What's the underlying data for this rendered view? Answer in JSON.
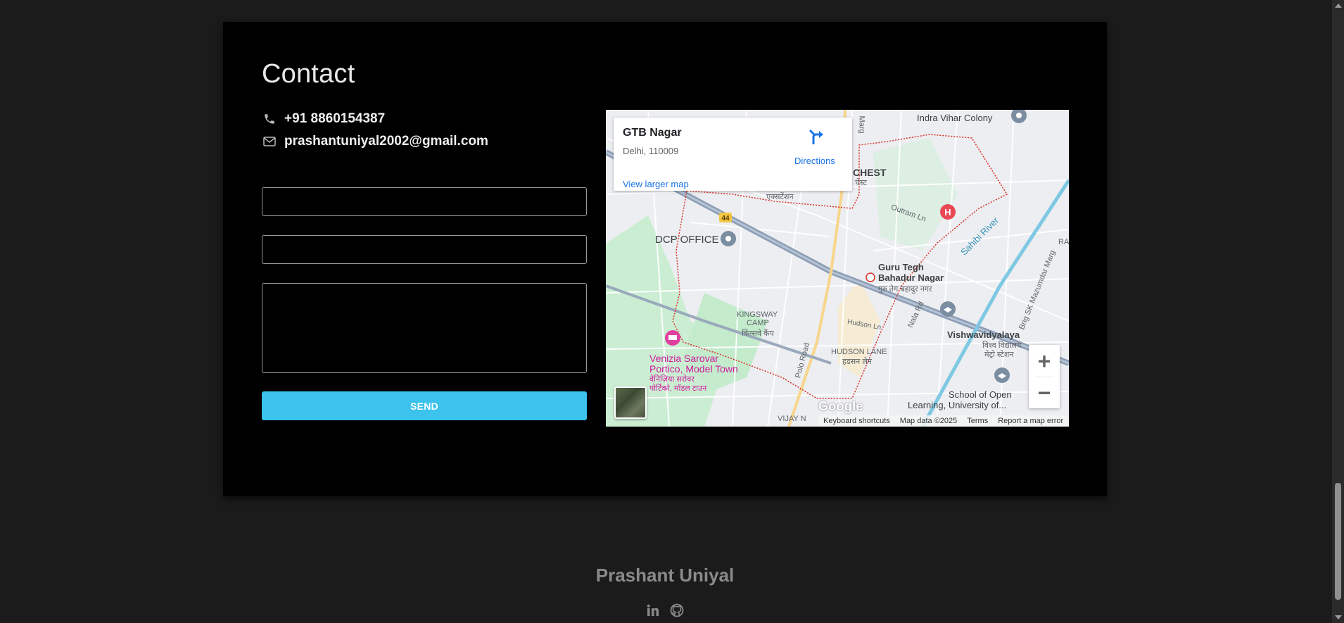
{
  "contact": {
    "title": "Contact",
    "phone": "+91 8860154387",
    "email": "prashantuniyal2002@gmail.com"
  },
  "form": {
    "name_value": "",
    "email_value": "",
    "message_value": "",
    "send_label": "SEND",
    "send_color": "#3bc2ed"
  },
  "map": {
    "place_name": "GTB Nagar",
    "place_address": "Delhi, 110009",
    "view_larger": "View larger map",
    "directions": "Directions",
    "zoom_in": "+",
    "zoom_out": "−",
    "google_logo": "Google",
    "attribution": {
      "shortcuts": "Keyboard shortcuts",
      "map_data": "Map data ©2025",
      "terms": "Terms",
      "report": "Report a map error"
    },
    "labels": {
      "indra": "Indra Vihar Colony",
      "chest": "CHEST",
      "chest_hi": "चेस्ट",
      "extension_hi": "एक्सटेंशन",
      "outram": "Outram Ln",
      "highway": "44",
      "dcp": "DCP OFFICE",
      "gtb1": "Guru Tegh",
      "gtb2": "Bahadur Nagar",
      "gtb_hi": "गुरु तेग बहादुर नगर",
      "sahibi": "Sahibi River",
      "brig": "Brig SK Mazumdar Marg",
      "kingsway": "KINGSWAY",
      "camp": "CAMP",
      "kingsway_hi": "किंग्सवे कैंप",
      "vishwa": "Vishwavidyalaya",
      "vishwa_hi1": "विश्व विद्यालय",
      "vishwa_hi2": "मेट्रो स्टेशन",
      "nala": "Nala Rd",
      "hudson_ln": "Hudson Ln",
      "hudson": "HUDSON LANE",
      "hudson_hi": "हडसन लेन",
      "polo": "Polo Road",
      "venizia1": "Venizia Sarovar",
      "venizia2": "Portico, Model Town",
      "venizia_hi1": "वेनिज़िया सरोवर",
      "venizia_hi2": "पोर्टिको, मॉडल टाउन",
      "school1": "School of Open",
      "school2": "Learning, University of...",
      "vijay": "VIJAY N",
      "marg": "Marg",
      "ra": "RA"
    }
  },
  "footer": {
    "name": "Prashant Uniyal",
    "linkedin_icon": "linkedin-icon",
    "github_icon": "github-icon"
  }
}
